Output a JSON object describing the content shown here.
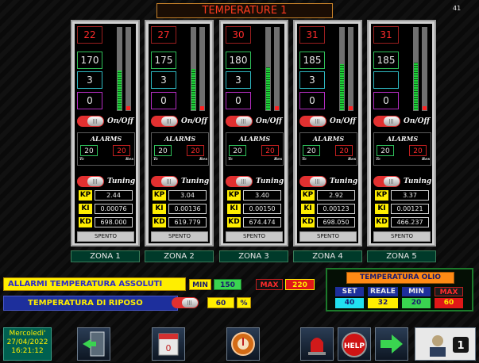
{
  "header": {
    "title": "TEMPERATURE 1",
    "page_number": "41"
  },
  "zones": [
    {
      "temp": "22",
      "setpoint": "170",
      "output": "3",
      "alarm": "0",
      "bar_level": 0.5,
      "onoff_label": "On/Off",
      "alarms_title": "ALARMS",
      "alarm_min": "20",
      "alarm_max": "20",
      "tc_label": "Tc",
      "res_label": "Res",
      "tuning_label": "Tuning",
      "kp_label": "KP",
      "kp": "2.44",
      "ki_label": "KI",
      "ki": "0.00076",
      "kd_label": "KD",
      "kd": "698.000",
      "status": "SPENTO",
      "zone_label": "ZONA 1"
    },
    {
      "temp": "27",
      "setpoint": "175",
      "output": "3",
      "alarm": "0",
      "bar_level": 0.52,
      "onoff_label": "On/Off",
      "alarms_title": "ALARMS",
      "alarm_min": "20",
      "alarm_max": "20",
      "tc_label": "Tc",
      "res_label": "Res",
      "tuning_label": "Tuning",
      "kp_label": "KP",
      "kp": "3.04",
      "ki_label": "KI",
      "ki": "0.00136",
      "kd_label": "KD",
      "kd": "619.779",
      "status": "SPENTO",
      "zone_label": "ZONA 2"
    },
    {
      "temp": "30",
      "setpoint": "180",
      "output": "3",
      "alarm": "0",
      "bar_level": 0.54,
      "onoff_label": "On/Off",
      "alarms_title": "ALARMS",
      "alarm_min": "20",
      "alarm_max": "20",
      "tc_label": "Tc",
      "res_label": "Res",
      "tuning_label": "Tuning",
      "kp_label": "KP",
      "kp": "3.40",
      "ki_label": "KI",
      "ki": "0.00150",
      "kd_label": "KD",
      "kd": "674.474",
      "status": "SPENTO",
      "zone_label": "ZONA 3"
    },
    {
      "temp": "31",
      "setpoint": "185",
      "output": "3",
      "alarm": "0",
      "bar_level": 0.58,
      "onoff_label": "On/Off",
      "alarms_title": "ALARMS",
      "alarm_min": "20",
      "alarm_max": "20",
      "tc_label": "Tc",
      "res_label": "Res",
      "tuning_label": "Tuning",
      "kp_label": "KP",
      "kp": "2.92",
      "ki_label": "KI",
      "ki": "0.00123",
      "kd_label": "KD",
      "kd": "698.050",
      "status": "SPENTO",
      "zone_label": "ZONA 4"
    },
    {
      "temp": "31",
      "setpoint": "185",
      "output": "",
      "alarm": "0",
      "bar_level": 0.6,
      "onoff_label": "On/Off",
      "alarms_title": "ALARMS",
      "alarm_min": "20",
      "alarm_max": "20",
      "tc_label": "Tc",
      "res_label": "Res",
      "tuning_label": "Tuning",
      "kp_label": "KP",
      "kp": "3.37",
      "ki_label": "KI",
      "ki": "0.00121",
      "kd_label": "KD",
      "kd": "466.237",
      "status": "SPENTO",
      "zone_label": "ZONA 5"
    }
  ],
  "absolute_alarms": {
    "label": "ALLARMI TEMPERATURA ASSOLUTI",
    "min_label": "MIN",
    "min_value": "150",
    "max_label": "MAX",
    "max_value": "220"
  },
  "rest_temperature": {
    "label": "TEMPERATURA DI RIPOSO",
    "value": "60",
    "unit": "%"
  },
  "oil_temperature": {
    "title": "TEMPERATURA OLIO",
    "set_label": "SET",
    "set_value": "40",
    "real_label": "REALE",
    "real_value": "32",
    "min_label": "MIN",
    "min_value": "20",
    "max_label": "MAX",
    "max_value": "60"
  },
  "toolbar": {
    "day": "Mercoledi'",
    "date": "27/04/2022",
    "time": "16:21:12",
    "user_badge": "1",
    "help_label": "HELP"
  },
  "colors": {
    "accent_red": "#ff2b2b",
    "accent_yellow": "#ffee00",
    "panel_green": "#2fc05a"
  }
}
